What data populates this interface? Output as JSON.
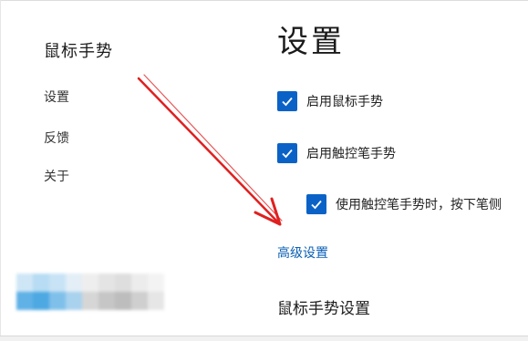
{
  "sidebar": {
    "title": "鼠标手势",
    "items": [
      {
        "label": "设置"
      },
      {
        "label": "反馈"
      },
      {
        "label": "关于"
      }
    ]
  },
  "main": {
    "title": "设置",
    "options": [
      {
        "label": "启用鼠标手势",
        "checked": true
      },
      {
        "label": "启用触控笔手势",
        "checked": true
      },
      {
        "label": "使用触控笔手势时，按下笔侧",
        "checked": true
      }
    ],
    "advanced_link": "高级设置",
    "section_title": "鼠标手势设置"
  },
  "colors": {
    "checkbox_fill": "#0a62c7",
    "link": "#0a5fb4",
    "annotation_arrow": "#e02020"
  }
}
